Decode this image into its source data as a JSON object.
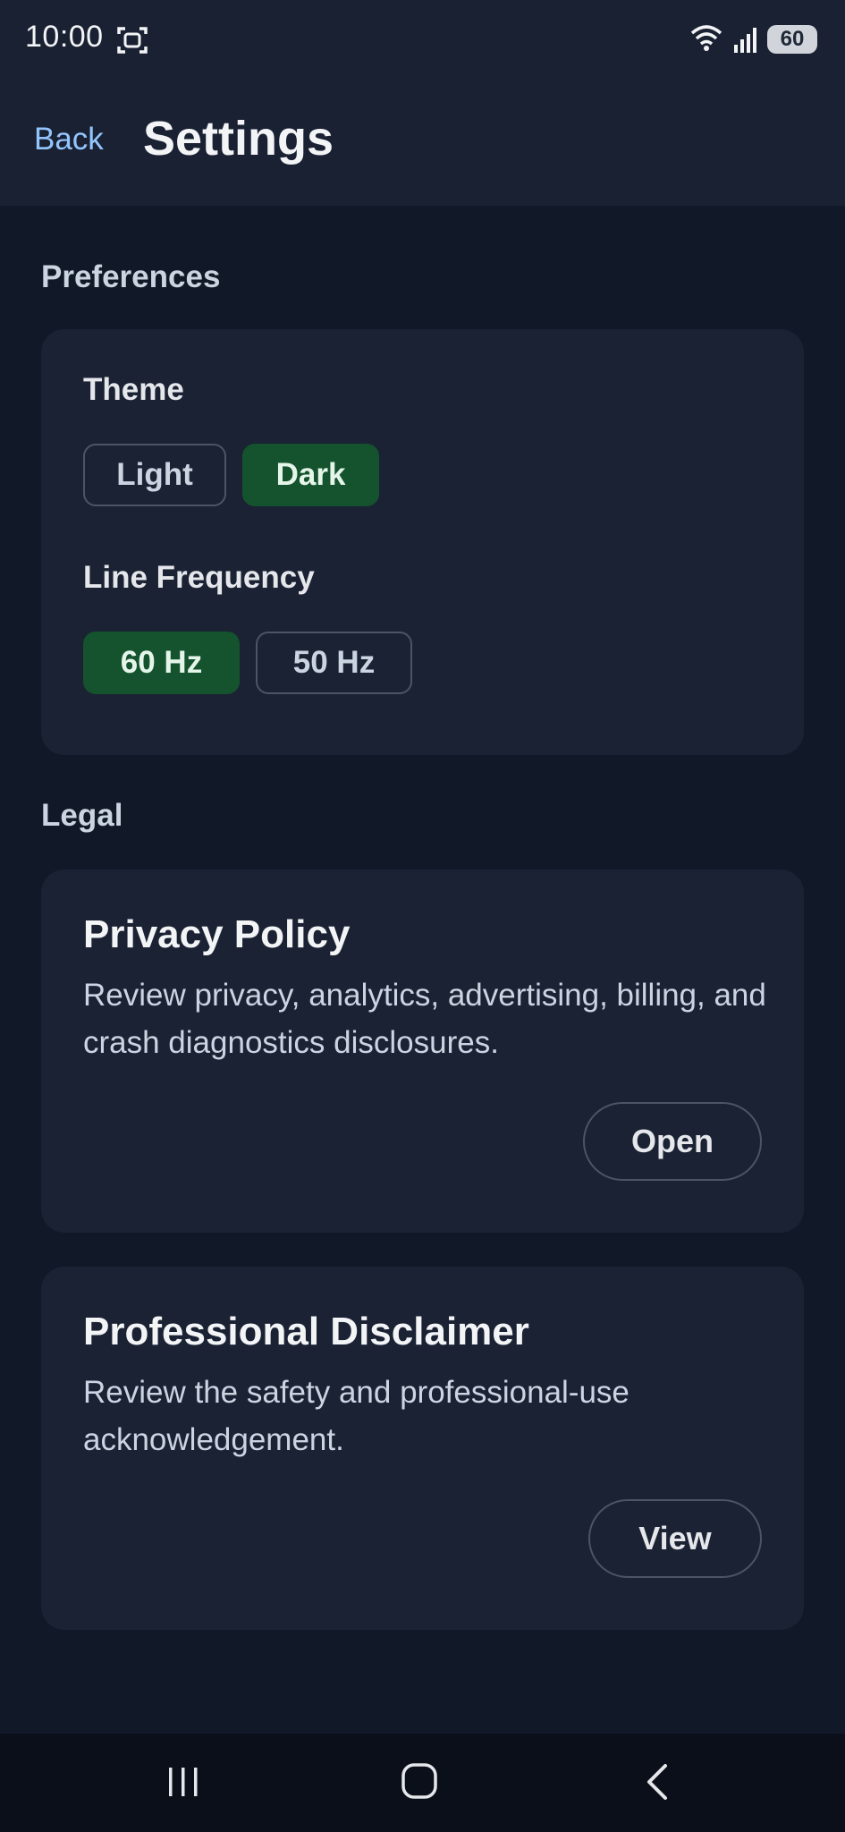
{
  "status_bar": {
    "time": "10:00",
    "battery": "60"
  },
  "header": {
    "back_label": "Back",
    "title": "Settings"
  },
  "preferences": {
    "section_label": "Preferences",
    "theme": {
      "label": "Theme",
      "options": [
        "Light",
        "Dark"
      ],
      "selected": "Dark"
    },
    "line_frequency": {
      "label": "Line Frequency",
      "options": [
        "60 Hz",
        "50 Hz"
      ],
      "selected": "60 Hz"
    }
  },
  "legal": {
    "section_label": "Legal",
    "privacy": {
      "title": "Privacy Policy",
      "description": "Review privacy, analytics, advertising, billing, and crash diagnostics disclosures.",
      "button_label": "Open"
    },
    "disclaimer": {
      "title": "Professional Disclaimer",
      "description": "Review the safety and professional-use acknowledgement.",
      "button_label": "View"
    }
  },
  "colors": {
    "background": "#111827",
    "card": "#1a2234",
    "accent_selected": "#14532d",
    "link": "#93c5fd"
  },
  "nav_icons": [
    "recent-apps-icon",
    "home-icon",
    "back-icon"
  ]
}
